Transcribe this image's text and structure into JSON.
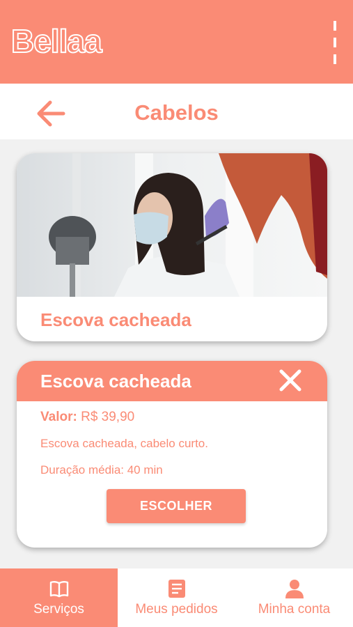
{
  "app": {
    "brand": "Bellaa",
    "colors": {
      "primary": "#fa8b75",
      "surface": "#ffffff",
      "background": "#f1f1f1"
    },
    "menu_icon": "kebab-menu-icon"
  },
  "header": {
    "back_icon": "arrow-left-icon",
    "title": "Cabelos"
  },
  "service_card": {
    "image": "woman-with-mask-getting-haircut-photo",
    "title": "Escova cacheada"
  },
  "detail_card": {
    "title": "Escova cacheada",
    "close_icon": "close-x-icon",
    "price_label": "Valor:",
    "price_value": "R$ 39,90",
    "description": "Escova cacheada, cabelo curto.",
    "duration": "Duração média: 40 min",
    "choose_label": "ESCOLHER"
  },
  "bottom_nav": {
    "items": [
      {
        "label": "Serviços",
        "icon": "book-icon",
        "active": true
      },
      {
        "label": "Meus pedidos",
        "icon": "list-document-icon",
        "active": false
      },
      {
        "label": "Minha conta",
        "icon": "user-icon",
        "active": false
      }
    ]
  }
}
